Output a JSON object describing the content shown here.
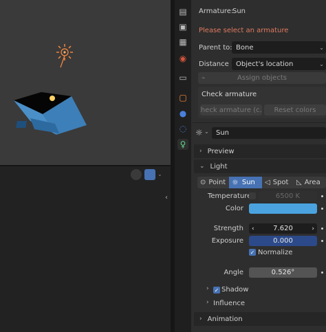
{
  "armature_panel": {
    "armature_label": "Armature:",
    "armature_value": "Sun",
    "warning": "Please select an armature",
    "parent_to_label": "Parent to:",
    "parent_to_value": "Bone",
    "distance_label": "Distance ...",
    "distance_value": "Object's location",
    "assign_button": "Assign objects",
    "check_armature_title": "Check armature",
    "check_armature_button": "Check armature (c...",
    "reset_colors_button": "Reset colors"
  },
  "light_selector": {
    "name": "Sun"
  },
  "sections": {
    "preview": "Preview",
    "light": "Light",
    "shadow": "Shadow",
    "influence": "Influence",
    "animation": "Animation"
  },
  "light_types": [
    "Point",
    "Sun",
    "Spot",
    "Area"
  ],
  "light_props": {
    "temperature_label": "Temperature",
    "temperature_value": "6500 K",
    "color_label": "Color",
    "color_value": "#4aa3df",
    "strength_label": "Strength",
    "strength_value": "7.620",
    "exposure_label": "Exposure",
    "exposure_value": "0.000",
    "normalize_label": "Normalize",
    "normalize_checked": true,
    "angle_label": "Angle",
    "angle_value": "0.526°",
    "shadow_checked": true
  },
  "colors": {
    "accent": "#4772b3",
    "warning": "#e07a5f",
    "viewport_bg": "#3a3a3a",
    "panel_bg": "#2e2e2e"
  }
}
